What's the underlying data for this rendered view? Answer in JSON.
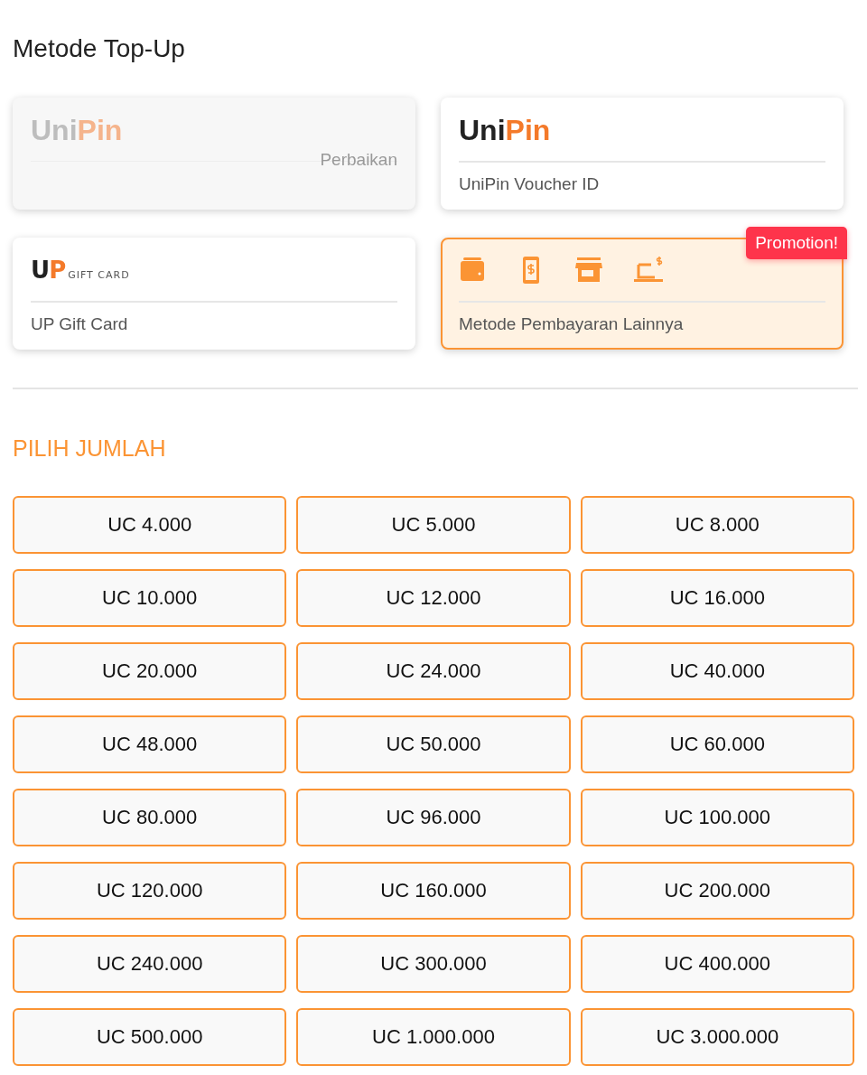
{
  "title": "Metode Top-Up",
  "methods": [
    {
      "kind": "logo",
      "logo": {
        "dark": "Uni",
        "accent": "Pin"
      },
      "status": "Perbaikan",
      "disabled": true,
      "selected": false
    },
    {
      "kind": "logo",
      "logo": {
        "dark": "Uni",
        "accent": "Pin"
      },
      "label": "UniPin Voucher ID",
      "disabled": false,
      "selected": false
    },
    {
      "kind": "giftlogo",
      "logo": {
        "dark": "U",
        "accent": "P",
        "sub": "GIFT CARD"
      },
      "label": "UP Gift Card",
      "disabled": false,
      "selected": false
    },
    {
      "kind": "icons",
      "label": "Metode Pembayaran Lainnya",
      "disabled": false,
      "selected": true
    }
  ],
  "promotion_badge": "Promotion!",
  "amount_heading": "PILIH JUMLAH",
  "amounts": [
    {
      "label": "UC 4.000",
      "selected": false
    },
    {
      "label": "UC 5.000",
      "selected": false
    },
    {
      "label": "UC 8.000",
      "selected": false
    },
    {
      "label": "UC 10.000",
      "selected": false
    },
    {
      "label": "UC 12.000",
      "selected": false
    },
    {
      "label": "UC 16.000",
      "selected": false
    },
    {
      "label": "UC 20.000",
      "selected": false
    },
    {
      "label": "UC 24.000",
      "selected": false
    },
    {
      "label": "UC 40.000",
      "selected": false
    },
    {
      "label": "UC 48.000",
      "selected": false
    },
    {
      "label": "UC 50.000",
      "selected": false
    },
    {
      "label": "UC 60.000",
      "selected": false
    },
    {
      "label": "UC 80.000",
      "selected": false
    },
    {
      "label": "UC 96.000",
      "selected": false
    },
    {
      "label": "UC 100.000",
      "selected": false
    },
    {
      "label": "UC 120.000",
      "selected": false
    },
    {
      "label": "UC 160.000",
      "selected": false
    },
    {
      "label": "UC 200.000",
      "selected": false
    },
    {
      "label": "UC 240.000",
      "selected": false
    },
    {
      "label": "UC 300.000",
      "selected": false
    },
    {
      "label": "UC 400.000",
      "selected": false
    },
    {
      "label": "UC 500.000",
      "selected": false
    },
    {
      "label": "UC 1.000.000",
      "selected": false
    },
    {
      "label": "UC 3.000.000",
      "selected": false
    }
  ]
}
